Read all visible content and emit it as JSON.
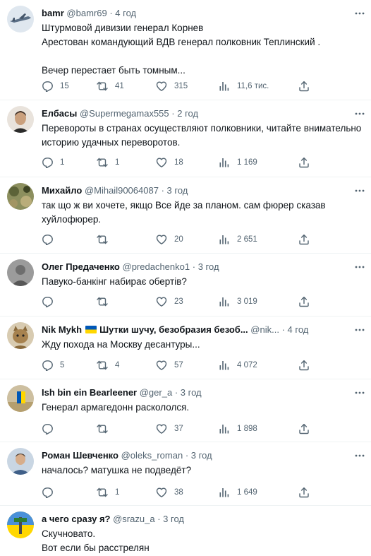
{
  "tweets": [
    {
      "name": "bamr",
      "handle": "@bamr69",
      "sep": "·",
      "time": "4 год",
      "flag": false,
      "text": "Штурмовой дивизии генерал Корнев\nАрестован командующий ВДВ генерал полковник Теплинский .\n\nВечер перестает быть томным...",
      "replies": "15",
      "retweets": "41",
      "likes": "315",
      "views": "11,6 тис.",
      "avatar": "jet-avatar"
    },
    {
      "name": "Елбасы",
      "handle": "@Supermegamax555",
      "sep": "·",
      "time": "2 год",
      "flag": false,
      "text": "Перевороты в странах осуществляют полковники, читайте внимательно историю удачных переворотов.",
      "replies": "1",
      "retweets": "1",
      "likes": "18",
      "views": "1 169",
      "avatar": "man-avatar"
    },
    {
      "name": "Михайло",
      "handle": "@Mihail90064087",
      "sep": "·",
      "time": "3 год",
      "flag": false,
      "text": "так що ж ви хочете, якщо Все йде за планом. сам фюрер сказав хуйлофюрер.",
      "replies": "",
      "retweets": "",
      "likes": "20",
      "views": "2 651",
      "avatar": "camo-avatar"
    },
    {
      "name": "Олег Предаченко",
      "handle": "@predachenko1",
      "sep": "·",
      "time": "3 год",
      "flag": false,
      "text": "Павуко-банкінг набирає обертів?",
      "replies": "",
      "retweets": "",
      "likes": "23",
      "views": "3 019",
      "avatar": "grey-avatar"
    },
    {
      "name": "Nik Mykh",
      "name2": "Шутки шучу, безобразия безоб...",
      "handle": "@nik...",
      "sep": "·",
      "time": "4 год",
      "flag": true,
      "text": "Жду похода на Москву десантуры...",
      "replies": "5",
      "retweets": "4",
      "likes": "57",
      "views": "4 072",
      "avatar": "cat-avatar"
    },
    {
      "name": "Ish bin ein Bearleener",
      "handle": "@ger_a",
      "sep": "·",
      "time": "3 год",
      "flag": false,
      "text": "Генерал армагедонн раскололся.",
      "replies": "",
      "retweets": "",
      "likes": "37",
      "views": "1 898",
      "avatar": "beach-avatar"
    },
    {
      "name": "Роман Шевченко",
      "handle": "@oleks_roman",
      "sep": "·",
      "time": "3 год",
      "flag": false,
      "text": "началось? матушка не подведёт?",
      "replies": "",
      "retweets": "1",
      "likes": "38",
      "views": "1 649",
      "avatar": "man2-avatar"
    },
    {
      "name": "а чего сразу я?",
      "handle": "@srazu_a",
      "sep": "·",
      "time": "3 год",
      "flag": false,
      "text": "Скучновато.\nВот если бы расстрелян",
      "replies": "",
      "retweets": "",
      "likes": "",
      "views": "",
      "avatar": "sign-avatar"
    }
  ]
}
